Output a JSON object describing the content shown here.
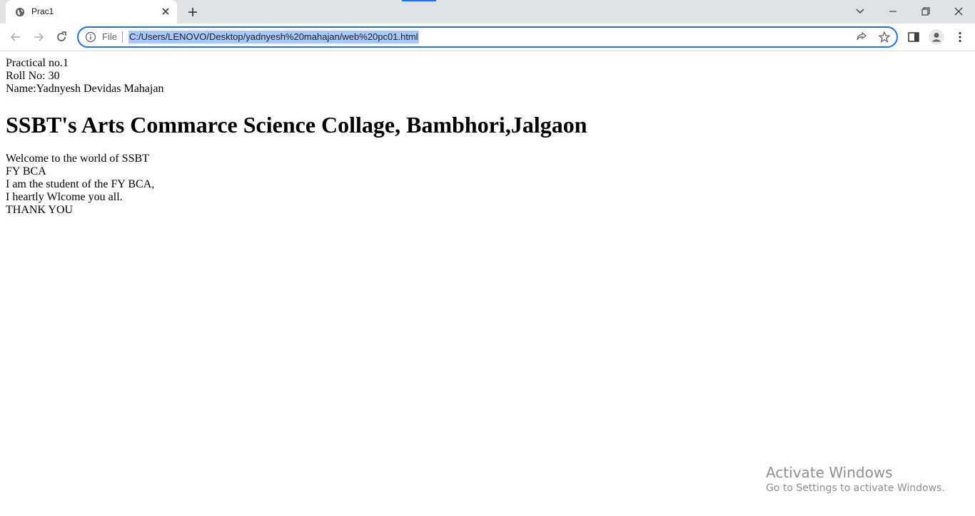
{
  "browser": {
    "tab": {
      "title": "Prac1"
    },
    "address": {
      "scheme_label": "File",
      "url": "C:/Users/LENOVO/Desktop/yadnyesh%20mahajan/web%20pc01.html"
    }
  },
  "page": {
    "intro_lines": [
      "Practical no.1",
      "Roll No: 30",
      "Name:Yadnyesh Devidas Mahajan"
    ],
    "heading": "SSBT's Arts Commarce Science Collage, Bambhori,Jalgaon",
    "body_lines": [
      "Welcome to the world of SSBT",
      "FY BCA",
      "I am the student of the FY BCA,",
      "I heartly Wlcome you all.",
      "THANK YOU"
    ]
  },
  "watermark": {
    "title": "Activate Windows",
    "subtitle": "Go to Settings to activate Windows."
  },
  "colors": {
    "accent": "#1a73e8",
    "tabstrip": "#dee1e6",
    "selection": "#a8c7fa"
  }
}
